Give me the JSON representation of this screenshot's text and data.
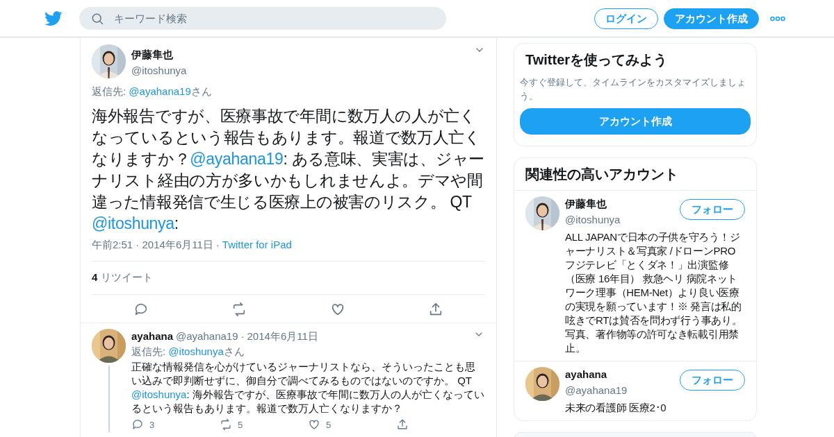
{
  "header": {
    "search": {
      "placeholder": "キーワード検索"
    },
    "buttons": [
      {
        "kind": "outline",
        "label": "ログイン"
      },
      {
        "kind": "solid",
        "label": "アカウント作成"
      }
    ]
  },
  "tweet": {
    "name": "伊藤隼也",
    "handle": "@itoshunya",
    "reply_to": [
      {
        "kind": "text",
        "text": "返信先: "
      },
      {
        "kind": "mention",
        "text": "@ayahana19"
      },
      {
        "kind": "text",
        "text": "さん"
      }
    ],
    "text": [
      {
        "kind": "text",
        "text": "海外報告ですが、医療事故で年間に数万人の人が亡くなっているという報告もあります。報道で数万人亡くなりますか？"
      },
      {
        "kind": "mention",
        "text": "@ayahana19"
      },
      {
        "kind": "text",
        "text": ": ある意味、実害は、ジャーナリスト経由の方が多いかもしれませんよ。デマや間違った情報発信で生じる医療上の被害のリスク。 QT "
      },
      {
        "kind": "mention",
        "text": "@itoshunya"
      },
      {
        "kind": "text",
        "text": ":"
      }
    ],
    "meta": [
      {
        "kind": "text",
        "text": "午前2:51 · 2014年6月11日"
      },
      {
        "kind": "text",
        "text": "·"
      },
      {
        "kind": "mention",
        "text": "Twitter for iPad"
      }
    ],
    "retweets": "**4** リツイート"
  },
  "reply": {
    "name": "ayahana",
    "handle": "@ayahana19",
    "separator": "·",
    "date": "2014年6月11日",
    "reply_to": [
      {
        "kind": "text",
        "text": "返信先: "
      },
      {
        "kind": "mention",
        "text": "@itoshunya"
      },
      {
        "kind": "text",
        "text": "さん"
      }
    ],
    "text": [
      {
        "kind": "text",
        "text": "正確な情報発信を心がけているジャーナリストなら、そういったことも思い込みで即判断せずに、御自分で調べてみるものではないのですか。 QT "
      },
      {
        "kind": "mention",
        "text": "@itoshunya"
      },
      {
        "kind": "text",
        "text": ": 海外報告ですが、医療事故で年間に数万人の人が亡くなっているという報告もあります。報道で数万人亡くなりますか？"
      }
    ],
    "actions": [
      {
        "kind": "reply",
        "count": "3"
      },
      {
        "kind": "retweet",
        "count": "5"
      },
      {
        "kind": "like",
        "count": "5"
      },
      {
        "kind": "share"
      }
    ]
  },
  "signup": {
    "title": "Twitterを使ってみよう",
    "text": "今すぐ登録して、タイムラインをカスタマイズしましょう。",
    "button": "アカウント作成"
  },
  "related": {
    "title": "関連性の高いアカウント",
    "accounts": [
      {
        "name": "伊藤隼也",
        "handle": "@itoshunya",
        "button": "フォロー",
        "bio": "ALL JAPANで日本の子供を守ろう！ジャーナリスト＆写真家 /ドローンPRO フジテレビ「とくダネ！」出演監修（医療 16年目） 救急ヘリ 病院ネットワーク理事（HEM-Net）より良い医療の実現を願っています！※ 発言は私的呟きでRTは賛否を問わず行う事あり。写真、著作物等の許可なき転載引用禁止。"
      },
      {
        "name": "ayahana",
        "handle": "@ayahana19",
        "button": "フォロー",
        "bio": "未来の看護師 医療2･0"
      }
    ]
  }
}
